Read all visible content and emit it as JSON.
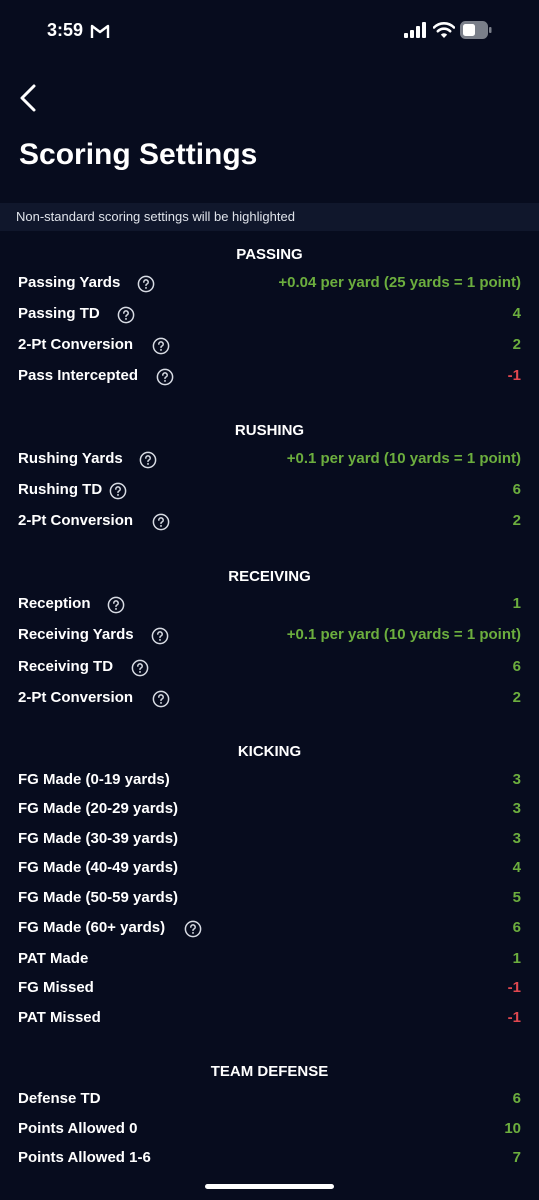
{
  "status_bar": {
    "time": "3:59"
  },
  "header": {
    "title": "Scoring Settings"
  },
  "notice": "Non-standard scoring settings will be highlighted",
  "colors": {
    "background": "#070c1e",
    "positive": "#6cae3e",
    "negative": "#e0474f",
    "notice_bg": "#10172c"
  },
  "sections": {
    "passing": {
      "title": "PASSING",
      "rows": [
        {
          "label": "Passing Yards",
          "value": "+0.04 per yard (25 yards = 1 point)"
        },
        {
          "label": "Passing TD",
          "value": "4"
        },
        {
          "label": "2-Pt Conversion",
          "value": "2"
        },
        {
          "label": "Pass Intercepted",
          "value": "-1"
        }
      ]
    },
    "rushing": {
      "title": "RUSHING",
      "rows": [
        {
          "label": "Rushing Yards",
          "value": "+0.1 per yard (10 yards = 1 point)"
        },
        {
          "label": "Rushing TD",
          "value": "6"
        },
        {
          "label": "2-Pt Conversion",
          "value": "2"
        }
      ]
    },
    "receiving": {
      "title": "RECEIVING",
      "rows": [
        {
          "label": "Reception",
          "value": "1"
        },
        {
          "label": "Receiving Yards",
          "value": "+0.1 per yard (10 yards = 1 point)"
        },
        {
          "label": "Receiving TD",
          "value": "6"
        },
        {
          "label": "2-Pt Conversion",
          "value": "2"
        }
      ]
    },
    "kicking": {
      "title": "KICKING",
      "rows": [
        {
          "label": "FG Made (0-19 yards)",
          "value": "3"
        },
        {
          "label": "FG Made (20-29 yards)",
          "value": "3"
        },
        {
          "label": "FG Made (30-39 yards)",
          "value": "3"
        },
        {
          "label": "FG Made (40-49 yards)",
          "value": "4"
        },
        {
          "label": "FG Made (50-59 yards)",
          "value": "5"
        },
        {
          "label": "FG Made (60+ yards)",
          "value": "6"
        },
        {
          "label": "PAT Made",
          "value": "1"
        },
        {
          "label": "FG Missed",
          "value": "-1"
        },
        {
          "label": "PAT Missed",
          "value": "-1"
        }
      ]
    },
    "team_defense": {
      "title": "TEAM DEFENSE",
      "rows": [
        {
          "label": "Defense TD",
          "value": "6"
        },
        {
          "label": "Points Allowed 0",
          "value": "10"
        },
        {
          "label": "Points Allowed 1-6",
          "value": "7"
        }
      ]
    }
  }
}
